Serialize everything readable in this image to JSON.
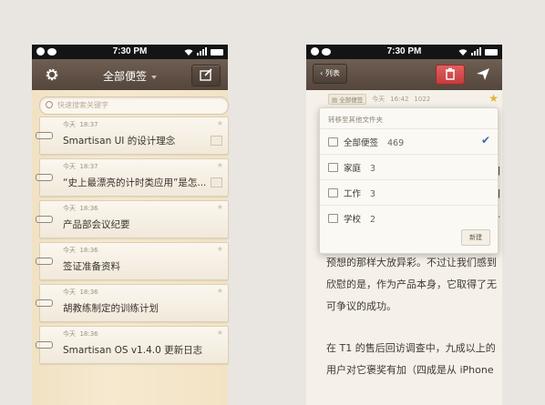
{
  "status_bar": {
    "time": "7:30 PM"
  },
  "left_phone": {
    "title": "全部便签",
    "search_placeholder": "快速搜索关键字",
    "notes": [
      {
        "date": "今天",
        "time": "18:37",
        "title": "Smartisan UI 的设计理念",
        "has_image": true
      },
      {
        "date": "今天",
        "time": "18:37",
        "title": "“史上最漂亮的计时类应用”是怎...",
        "has_image": true
      },
      {
        "date": "今天",
        "time": "18:36",
        "title": "产品部会议纪要",
        "has_image": false
      },
      {
        "date": "今天",
        "time": "18:36",
        "title": "签证准备资料",
        "has_image": false
      },
      {
        "date": "今天",
        "time": "18:36",
        "title": "胡教练制定的训练计划",
        "has_image": false
      },
      {
        "date": "今天",
        "time": "18:36",
        "title": "Smartisan OS v1.4.0 更新日志",
        "has_image": false
      }
    ]
  },
  "right_phone": {
    "back_label": "列表",
    "folder_tag": "全部便签",
    "date": "今天",
    "time": "16:42",
    "char_count": "1022",
    "body_lines": [
      "预想的那样大放异彩。不过让我们感到",
      "欣慰的是，作为产品本身，它取得了无",
      "可争议的成功。",
      "",
      "在 T1 的售后回访调查中，九成以上的",
      "用户对它褒奖有加（四成是从 iPhone"
    ],
    "peek_chars": [
      "]",
      "]",
      "-"
    ],
    "dropdown": {
      "title": "转移至其他文件夹",
      "items": [
        {
          "name": "全部便签",
          "count": "469",
          "selected": true
        },
        {
          "name": "家庭",
          "count": "3",
          "selected": false
        },
        {
          "name": "工作",
          "count": "3",
          "selected": false
        },
        {
          "name": "学校",
          "count": "2",
          "selected": false
        }
      ],
      "new_label": "新建"
    }
  },
  "colors": {
    "titlebar": "#5e4f44",
    "delete": "#d04848",
    "check": "#3c68b0",
    "star": "#e5b23a"
  }
}
